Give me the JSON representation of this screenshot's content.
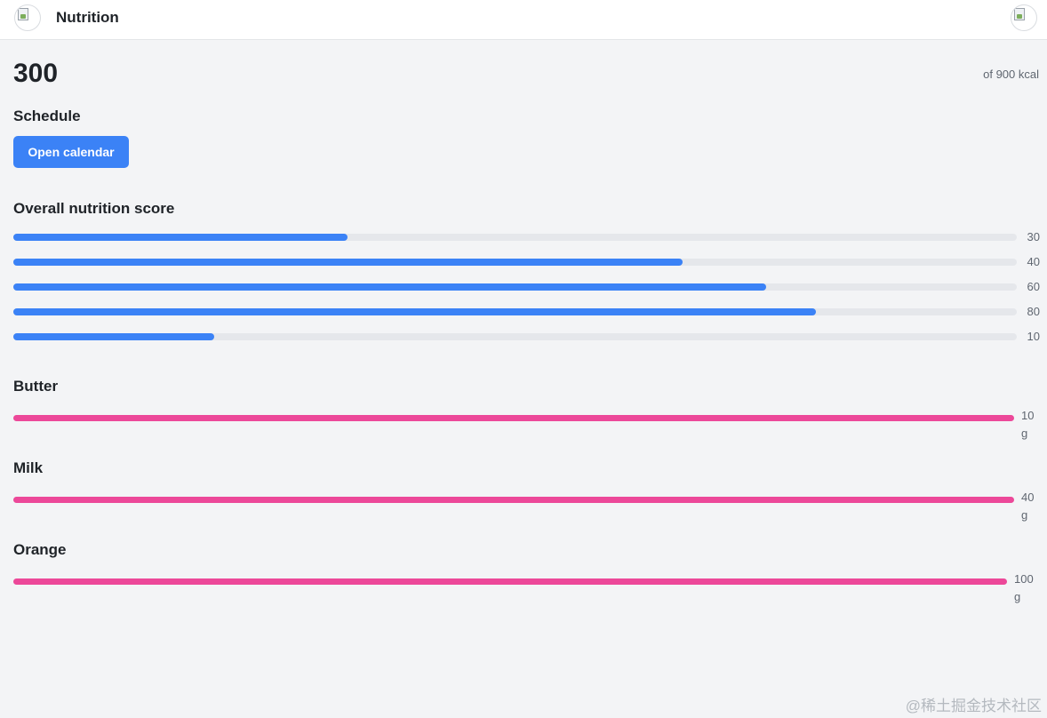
{
  "header": {
    "title": "Nutrition",
    "left_avatar_icon": "broken-image-icon",
    "right_avatar_icon": "broken-image-icon"
  },
  "calories": {
    "value": "300",
    "target": "of 900 kcal"
  },
  "schedule": {
    "title": "Schedule",
    "button_label": "Open calendar"
  },
  "score": {
    "title": "Overall nutrition score",
    "bars": [
      {
        "label": "30",
        "fill_fraction": 0.333
      },
      {
        "label": "40",
        "fill_fraction": 0.667
      },
      {
        "label": "60",
        "fill_fraction": 0.75
      },
      {
        "label": "80",
        "fill_fraction": 0.8
      },
      {
        "label": "10",
        "fill_fraction": 0.2
      }
    ]
  },
  "foods": [
    {
      "name": "Butter",
      "amount": "10",
      "unit": "g",
      "fill_fraction": 1.0
    },
    {
      "name": "Milk",
      "amount": "40",
      "unit": "g",
      "fill_fraction": 1.0
    },
    {
      "name": "Orange",
      "amount": "100",
      "unit": "g",
      "fill_fraction": 1.0
    }
  ],
  "watermark": "@稀土掘金技术社区",
  "colors": {
    "accent": "#3b82f6",
    "food_bar": "#ec4899",
    "track": "#e5e7eb",
    "background": "#f3f4f6"
  }
}
